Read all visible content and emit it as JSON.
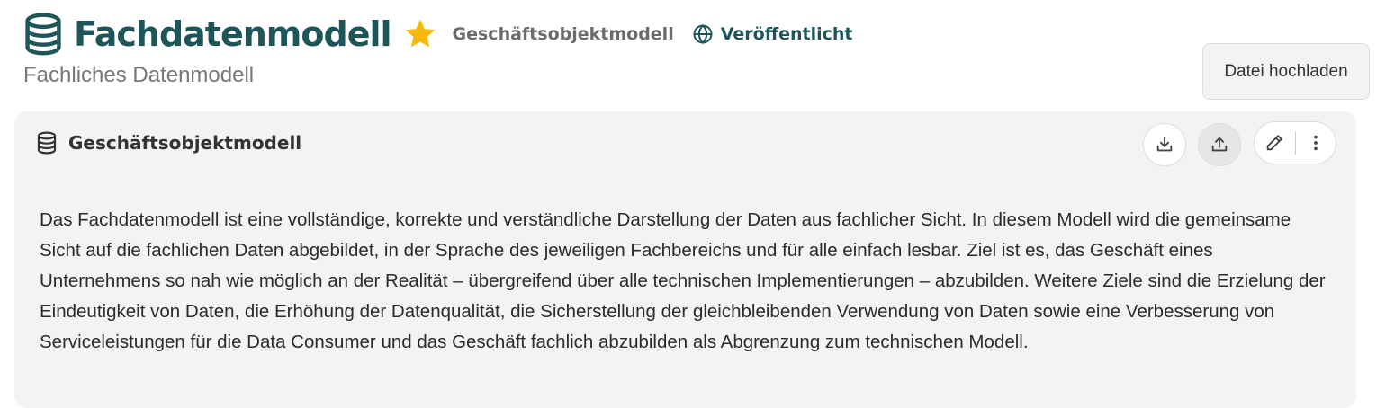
{
  "header": {
    "title": "Fachdatenmodell",
    "type_label": "Geschäftsobjektmodell",
    "status": "Veröffentlicht",
    "subtitle": "Fachliches Datenmodell",
    "title_icon": "database-icon",
    "favorite_icon": "star-icon",
    "status_icon": "globe-icon"
  },
  "actions": {
    "upload_label": "Datei hochladen"
  },
  "panel": {
    "title": "Geschäftsobjektmodell",
    "icon": "database-icon",
    "buttons": [
      "download-icon",
      "upload-icon",
      "pencil-icon",
      "more-vertical-icon"
    ],
    "description": "Das Fachdatenmodell ist eine vollständige, korrekte und verständliche Darstellung der Daten aus fachlicher Sicht. In diesem Modell wird die gemeinsame Sicht auf die fachlichen Daten abgebildet, in der Sprache des jeweiligen Fachbereichs und für alle einfach lesbar. Ziel ist es, das Geschäft eines Unternehmens so nah wie möglich an der Realität – übergreifend über alle technischen Implementierungen – abzubilden. Weitere Ziele sind die Erzielung der Eindeutigkeit von Daten, die Erhöhung der Datenqualität, die Sicherstellung der gleichbleibenden Verwendung von Daten sowie eine Verbesserung von Serviceleistungen für die Data Consumer und das Geschäft fachlich abzubilden als Abgrenzung zum technischen Modell."
  },
  "colors": {
    "brand": "#1d5559",
    "star": "#f5b80c",
    "panel_bg": "#f3f3f3"
  }
}
